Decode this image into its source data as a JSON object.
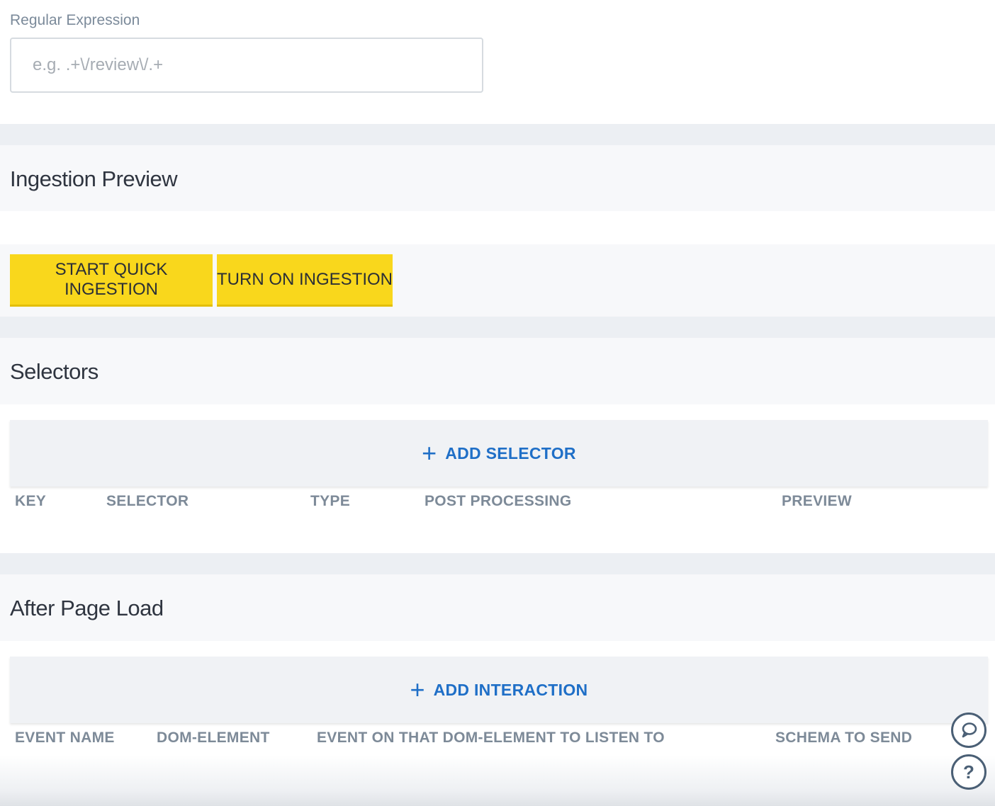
{
  "regex": {
    "label": "Regular Expression",
    "placeholder": "e.g. .+\\/review\\/.+",
    "value": ""
  },
  "ingestion_preview": {
    "title": "Ingestion Preview",
    "start_quick_label": "START QUICK INGESTION",
    "turn_on_label": "TURN ON INGESTION"
  },
  "selectors": {
    "title": "Selectors",
    "add_label": "ADD SELECTOR",
    "columns": [
      "KEY",
      "SELECTOR",
      "TYPE",
      "POST PROCESSING",
      "PREVIEW"
    ]
  },
  "after_page_load": {
    "title": "After Page Load",
    "add_label": "ADD INTERACTION",
    "columns": [
      "EVENT NAME",
      "DOM-ELEMENT",
      "EVENT ON THAT DOM-ELEMENT TO LISTEN TO",
      "SCHEMA TO SEND"
    ]
  },
  "floating": {
    "help_glyph": "?"
  },
  "colors": {
    "accent_yellow": "#f9d71c",
    "link_blue": "#1f6fc7",
    "muted_text": "#7d8a98"
  }
}
